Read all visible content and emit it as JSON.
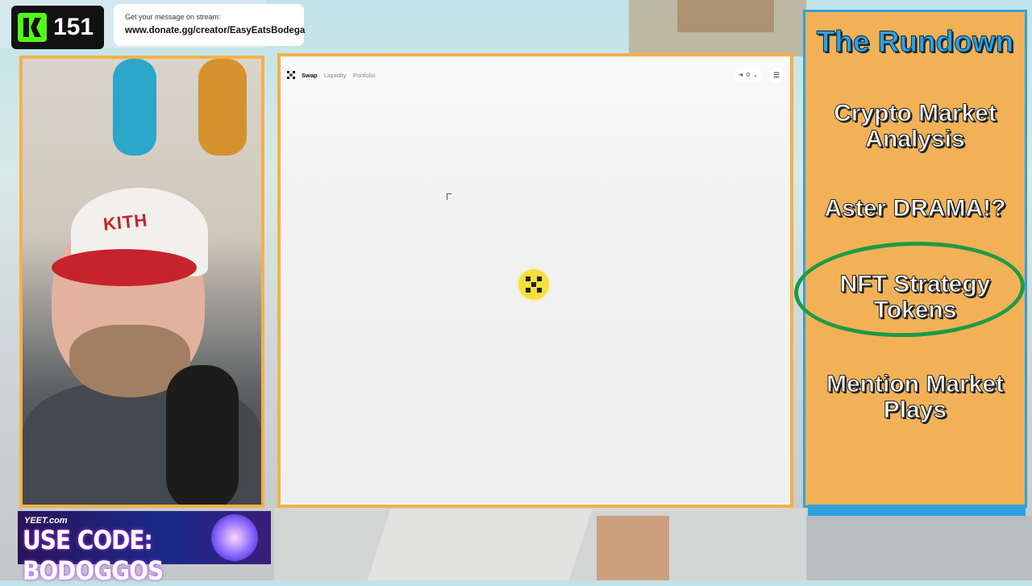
{
  "counter": {
    "value": "151"
  },
  "donate": {
    "prompt": "Get your message on stream:",
    "url": "www.donate.gg/creator/EasyEatsBodega"
  },
  "webcam": {
    "hat_text": "KITH"
  },
  "browser": {
    "nav": {
      "links": [
        {
          "label": "Swap",
          "active": true
        },
        {
          "label": "Liquidity",
          "active": false
        },
        {
          "label": "Portfolio",
          "active": false
        }
      ],
      "wallet_balance": "0",
      "menu_icon": "hamburger-icon"
    },
    "loader_icon": "app-logo-icon",
    "accent": "#f5e03a"
  },
  "rundown": {
    "title": "The Rundown",
    "items": [
      {
        "label": "Crypto Market Analysis",
        "highlighted": false
      },
      {
        "label": "Aster DRAMA!?",
        "highlighted": false
      },
      {
        "label": "NFT Strategy Tokens",
        "highlighted": true
      },
      {
        "label": "Mention Market Plays",
        "highlighted": false
      }
    ],
    "colors": {
      "panel": "#f2b156",
      "title": "#2fa2e0",
      "highlight_circle": "#1e9a46"
    }
  },
  "banner": {
    "brand": "YEET.com",
    "code_text": "USE CODE: BODOGGOS"
  }
}
